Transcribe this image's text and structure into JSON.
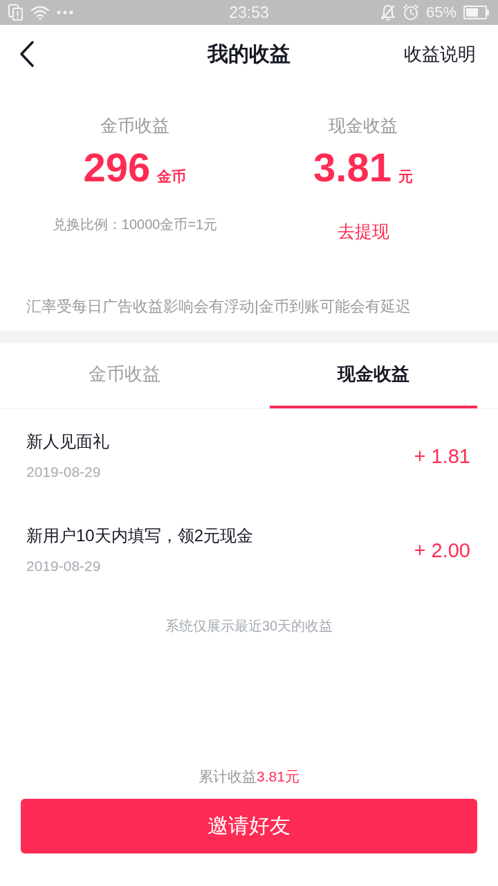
{
  "status_bar": {
    "time": "23:53",
    "battery_text": "65%"
  },
  "header": {
    "title": "我的收益",
    "action": "收益说明"
  },
  "summary": [
    {
      "label": "金币收益",
      "value": "296",
      "unit": "金币",
      "note": {
        "kind": "text",
        "text": "兑换比例：10000金币=1元"
      }
    },
    {
      "label": "现金收益",
      "value": "3.81",
      "unit": "元",
      "note": {
        "kind": "link",
        "text": "去提现"
      }
    }
  ],
  "notice": "汇率受每日广告收益影响会有浮动|金币到账可能会有延迟",
  "tabs": [
    {
      "label": "金币收益",
      "selected": false
    },
    {
      "label": "现金收益",
      "selected": true
    }
  ],
  "records": [
    {
      "title": "新人见面礼",
      "date": "2019-08-29",
      "amount": "+ 1.81"
    },
    {
      "title": "新用户10天内填写，领2元现金",
      "date": "2019-08-29",
      "amount": "+ 2.00"
    }
  ],
  "footnote": "系统仅展示最近30天的收益",
  "total": {
    "label": "累计收益",
    "value": "3.81元"
  },
  "button": "邀请好友"
}
